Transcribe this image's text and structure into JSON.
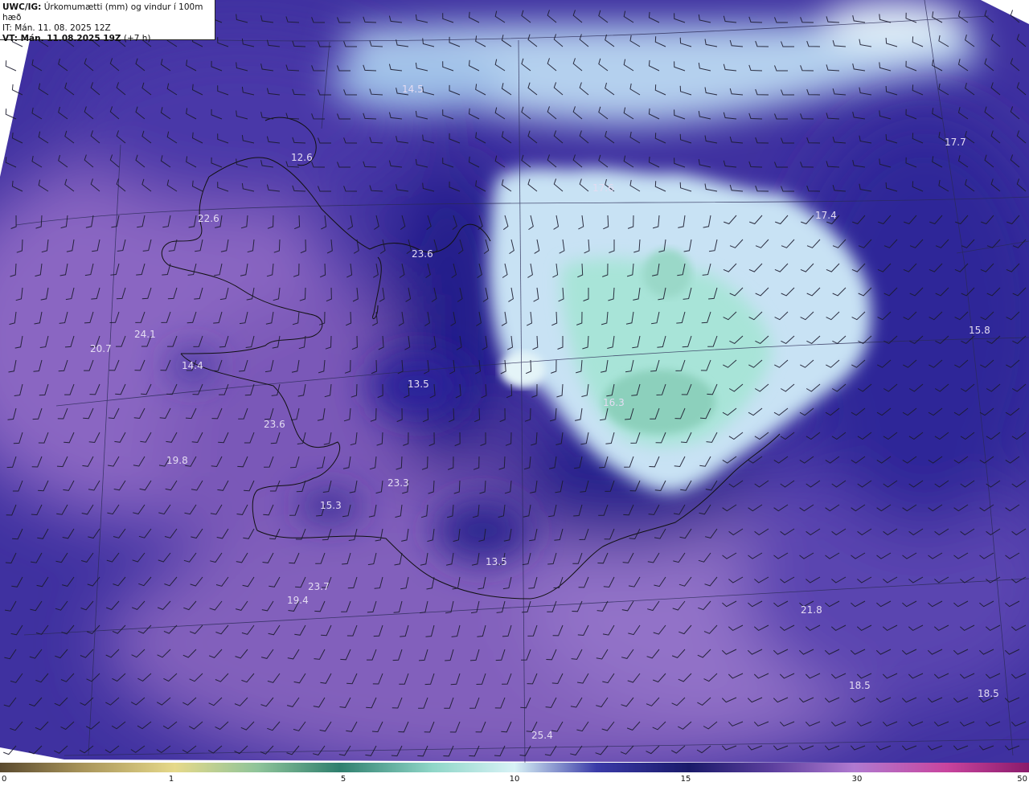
{
  "header": {
    "title_prefix": "UWC/IG:",
    "title_text": " Úrkomumætti (mm) og vindur í 100m hæð",
    "it_line": "IT: Mán. 11. 08. 2025 12Z",
    "vt_prefix": "VT: Mán. 11.08.2025 19Z",
    "vt_suffix": " (+7 h)"
  },
  "map_labels": [
    {
      "text": "12.6"
    },
    {
      "text": "22.6"
    },
    {
      "text": "23.6"
    },
    {
      "text": "24.1"
    },
    {
      "text": "20.7"
    },
    {
      "text": "14.4"
    },
    {
      "text": "13.5"
    },
    {
      "text": "23.6"
    },
    {
      "text": "19.8"
    },
    {
      "text": "23.3"
    },
    {
      "text": "15.3"
    },
    {
      "text": "13.5"
    },
    {
      "text": "23.7"
    },
    {
      "text": "19.4"
    },
    {
      "text": "17.6"
    },
    {
      "text": "17.4"
    },
    {
      "text": "17.7"
    },
    {
      "text": "15.8"
    },
    {
      "text": "16.3"
    },
    {
      "text": "21.8"
    },
    {
      "text": "18.5"
    },
    {
      "text": "18.5"
    },
    {
      "text": "25.4"
    },
    {
      "text": "14.5"
    }
  ],
  "colorbar": {
    "ticks": [
      "0",
      "1",
      "5",
      "10",
      "15",
      "30",
      "50"
    ],
    "colors": [
      "#5a4a2e",
      "#a8945a",
      "#e6d98a",
      "#8fc49a",
      "#2f7f6e",
      "#8fd6c8",
      "#d8f2f6",
      "#3a3aa8",
      "#1a1a6a",
      "#5c3f9e",
      "#b07ad0",
      "#c8449e",
      "#8a1a6a"
    ]
  }
}
